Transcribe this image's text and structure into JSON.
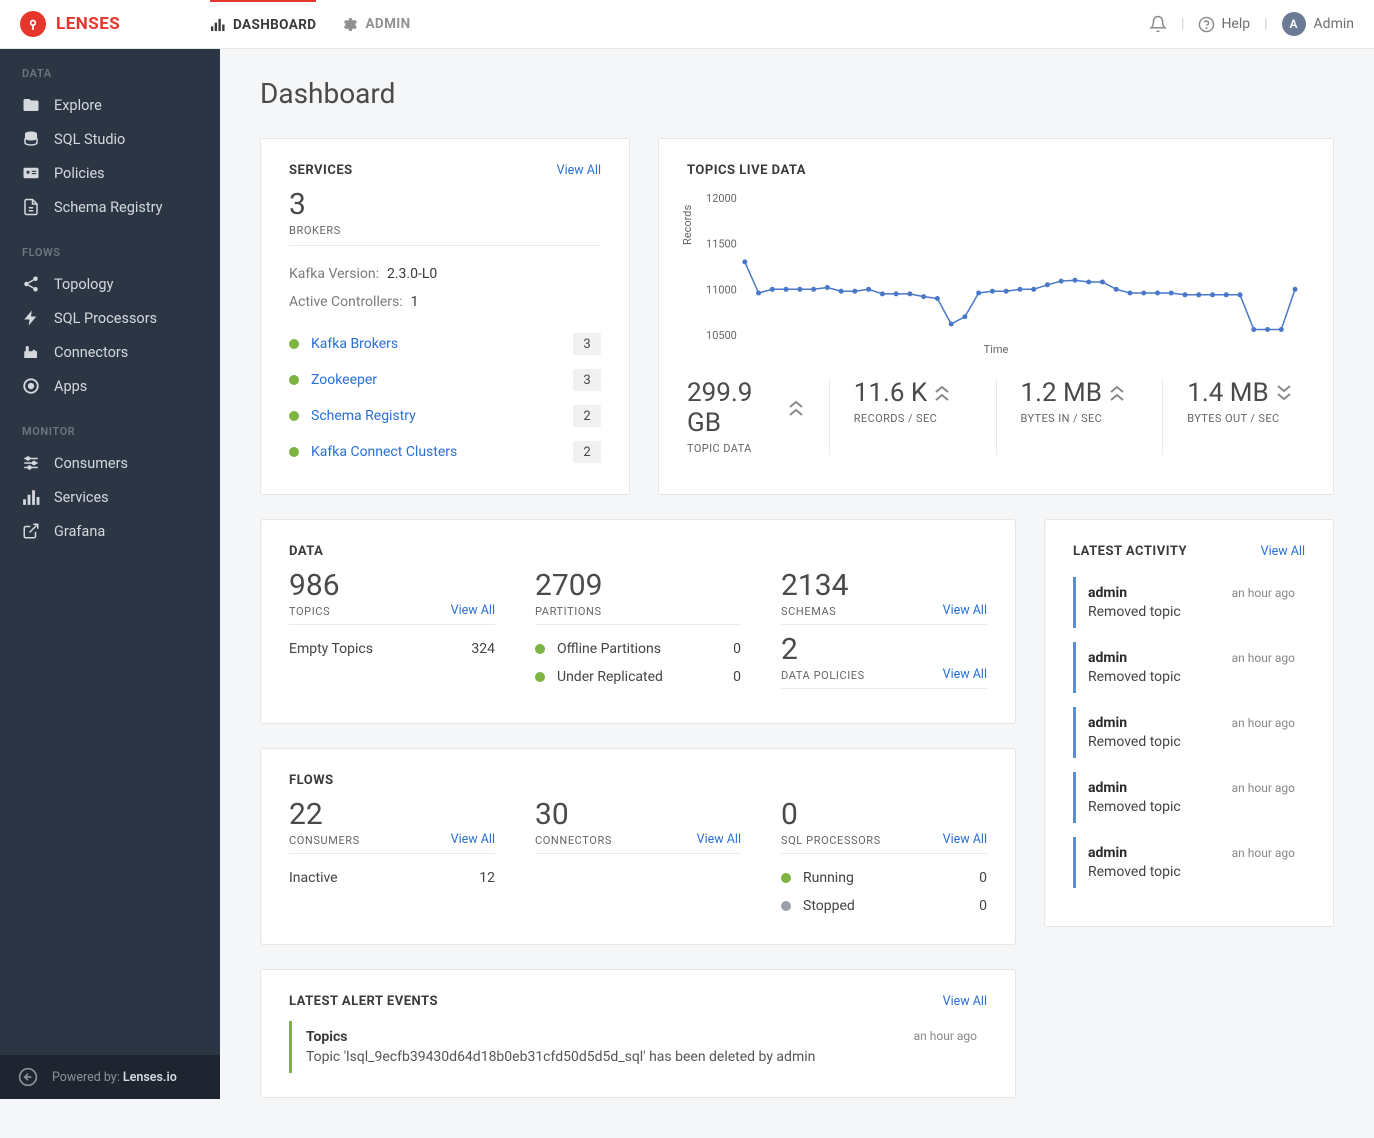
{
  "brand": "LENSES",
  "topnav": {
    "dashboard": "DASHBOARD",
    "admin": "ADMIN"
  },
  "top_right": {
    "help": "Help",
    "user_initial": "A",
    "user_name": "Admin"
  },
  "sidebar": {
    "sections": [
      {
        "header": "DATA",
        "items": [
          {
            "label": "Explore"
          },
          {
            "label": "SQL Studio"
          },
          {
            "label": "Policies"
          },
          {
            "label": "Schema Registry"
          }
        ]
      },
      {
        "header": "FLOWS",
        "items": [
          {
            "label": "Topology"
          },
          {
            "label": "SQL Processors"
          },
          {
            "label": "Connectors"
          },
          {
            "label": "Apps"
          }
        ]
      },
      {
        "header": "MONITOR",
        "items": [
          {
            "label": "Consumers"
          },
          {
            "label": "Services"
          },
          {
            "label": "Grafana"
          }
        ]
      }
    ],
    "footer": {
      "powered_prefix": "Powered by: ",
      "powered_name": "Lenses.io"
    }
  },
  "page_title": "Dashboard",
  "services": {
    "title": "SERVICES",
    "viewall": "View All",
    "brokers_count": "3",
    "brokers_label": "BROKERS",
    "kafka_version_label": "Kafka Version:",
    "kafka_version_value": "2.3.0-L0",
    "active_controllers_label": "Active Controllers:",
    "active_controllers_value": "1",
    "rows": [
      {
        "name": "Kafka Brokers",
        "count": "3"
      },
      {
        "name": "Zookeeper",
        "count": "3"
      },
      {
        "name": "Schema Registry",
        "count": "2"
      },
      {
        "name": "Kafka Connect Clusters",
        "count": "2"
      }
    ]
  },
  "topics_live": {
    "title": "TOPICS LIVE DATA",
    "ylabel": "Records",
    "xlabel": "Time",
    "metrics": [
      {
        "value": "299.9 GB",
        "arrow": "up2",
        "label": "TOPIC DATA"
      },
      {
        "value": "11.6 K",
        "arrow": "up2",
        "label": "RECORDS / SEC"
      },
      {
        "value": "1.2 MB",
        "arrow": "up2",
        "label": "BYTES IN / SEC"
      },
      {
        "value": "1.4 MB",
        "arrow": "down2",
        "label": "BYTES OUT / SEC"
      }
    ]
  },
  "chart_data": {
    "type": "line",
    "ylabel": "Records",
    "xlabel": "Time",
    "ylim": [
      10500,
      12000
    ],
    "yticks": [
      10500,
      11000,
      11500,
      12000
    ],
    "values": [
      11300,
      10960,
      11000,
      11000,
      11000,
      11000,
      11020,
      10980,
      10980,
      11000,
      10950,
      10950,
      10950,
      10920,
      10900,
      10620,
      10700,
      10960,
      10980,
      10980,
      11000,
      11000,
      11050,
      11090,
      11100,
      11080,
      11080,
      11000,
      10960,
      10960,
      10960,
      10960,
      10940,
      10940,
      10940,
      10940,
      10940,
      10560,
      10560,
      10560,
      11000
    ]
  },
  "data_card": {
    "title": "DATA",
    "topics_value": "986",
    "topics_label": "TOPICS",
    "topics_viewall": "View All",
    "empty_topics_label": "Empty Topics",
    "empty_topics_value": "324",
    "partitions_value": "2709",
    "partitions_label": "PARTITIONS",
    "offline_label": "Offline Partitions",
    "offline_value": "0",
    "under_repl_label": "Under Replicated",
    "under_repl_value": "0",
    "schemas_value": "2134",
    "schemas_label": "SCHEMAS",
    "schemas_viewall": "View All",
    "policies_value": "2",
    "policies_label": "DATA POLICIES",
    "policies_viewall": "View All"
  },
  "flows_card": {
    "title": "FLOWS",
    "consumers_value": "22",
    "consumers_label": "CONSUMERS",
    "consumers_viewall": "View All",
    "inactive_label": "Inactive",
    "inactive_value": "12",
    "connectors_value": "30",
    "connectors_label": "CONNECTORS",
    "connectors_viewall": "View All",
    "processors_value": "0",
    "processors_label": "SQL PROCESSORS",
    "processors_viewall": "View All",
    "running_label": "Running",
    "running_value": "0",
    "stopped_label": "Stopped",
    "stopped_value": "0"
  },
  "latest_activity": {
    "title": "LATEST ACTIVITY",
    "viewall": "View All",
    "items": [
      {
        "user": "admin",
        "time": "an hour ago",
        "msg": "Removed topic"
      },
      {
        "user": "admin",
        "time": "an hour ago",
        "msg": "Removed topic"
      },
      {
        "user": "admin",
        "time": "an hour ago",
        "msg": "Removed topic"
      },
      {
        "user": "admin",
        "time": "an hour ago",
        "msg": "Removed topic"
      },
      {
        "user": "admin",
        "time": "an hour ago",
        "msg": "Removed topic"
      }
    ]
  },
  "latest_alerts": {
    "title": "LATEST ALERT EVENTS",
    "viewall": "View All",
    "item": {
      "title": "Topics",
      "time": "an hour ago",
      "msg": "Topic 'lsql_9ecfb39430d64d18b0eb31cfd50d5d5d_sql' has been deleted by admin"
    }
  }
}
